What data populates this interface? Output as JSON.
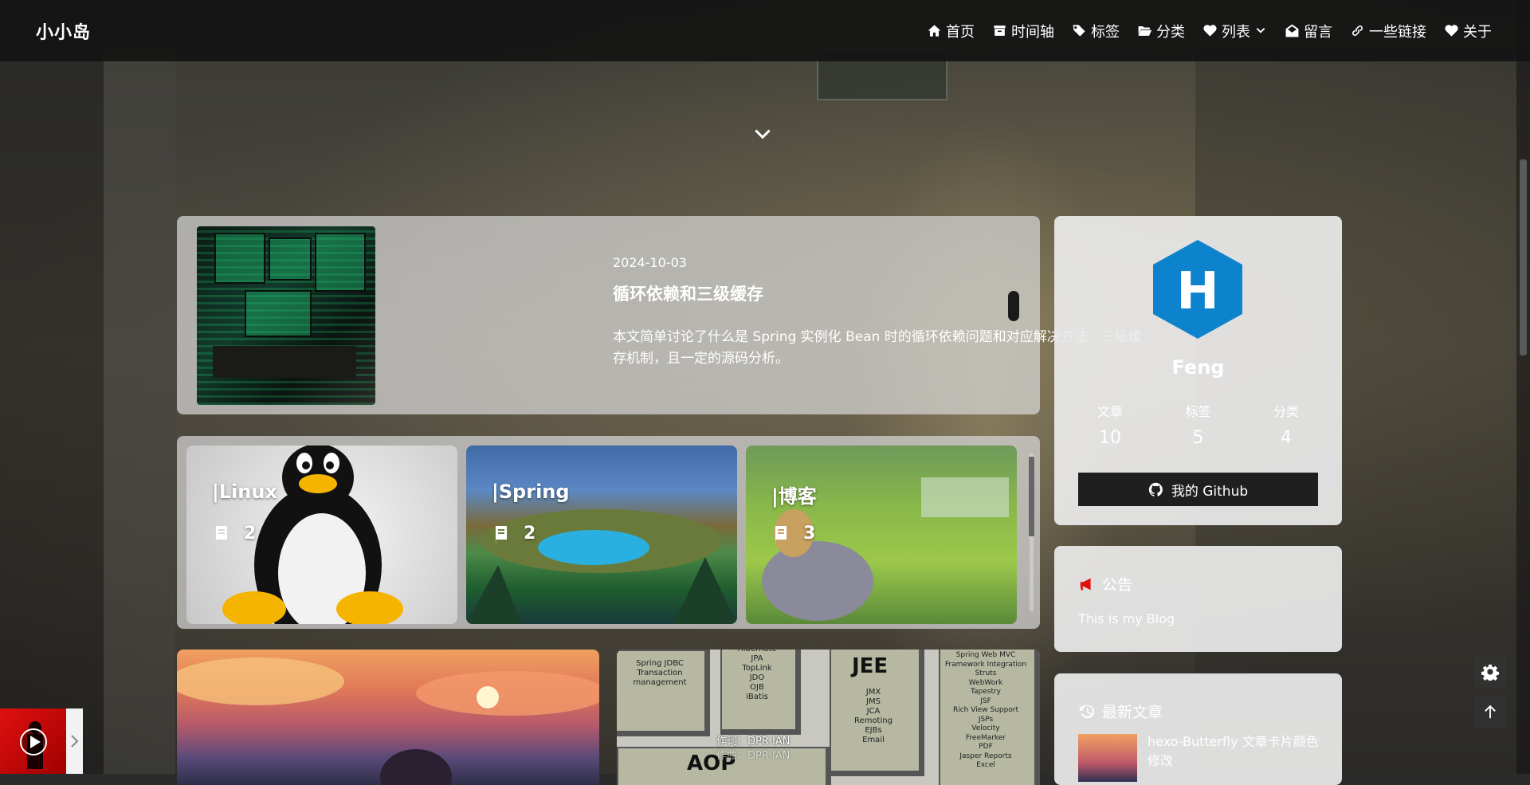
{
  "site": {
    "brand": "小小岛"
  },
  "nav": {
    "items": [
      {
        "label": "首页",
        "icon": "home-icon"
      },
      {
        "label": "时间轴",
        "icon": "archive-icon"
      },
      {
        "label": "标签",
        "icon": "tags-icon"
      },
      {
        "label": "分类",
        "icon": "folder-open-icon"
      },
      {
        "label": "列表",
        "icon": "heartbeat-icon"
      },
      {
        "label": "留言",
        "icon": "envelope-open-icon"
      },
      {
        "label": "一些链接",
        "icon": "link-icon"
      },
      {
        "label": "关于",
        "icon": "heart-icon"
      }
    ]
  },
  "featured_post": {
    "date": "2024-10-03",
    "title": "循环依赖和三级缓存",
    "excerpt": "本文简单讨论了什么是 Spring 实例化 Bean 时的循环依赖问题和对应解决方法：三级缓存机制，且一定的源码分析。"
  },
  "categories": [
    {
      "name": "|Linux",
      "count": "2"
    },
    {
      "name": "|Spring",
      "count": "2"
    },
    {
      "name": "|博客",
      "count": "3"
    }
  ],
  "bottom_cards": {
    "jee_title": "JEE",
    "aop_title": "AOP",
    "credit_lyric": "作词：DPR IAN",
    "credit_music": "作曲：DPR IAN",
    "jee_lists": {
      "col1": "Spring JDBC\nTransaction\nmanagement",
      "col2": "Hibernate\nJPA\nTopLink\nJDO\nOJB\niBatis",
      "col3": "JMX\nJMS\nJCA\nRemoting\nEJBs\nEmail",
      "col4": "Spring Web MVC\nFramework Integration\nStruts\nWebWork\nTapestry\nJSF\nRich View Support\nJSPs\nVelocity\nFreeMarker\nPDF\nJasper Reports\nExcel"
    }
  },
  "profile": {
    "avatar_letter": "H",
    "author": "Feng",
    "stats": [
      {
        "label": "文章",
        "value": "10"
      },
      {
        "label": "标签",
        "value": "5"
      },
      {
        "label": "分类",
        "value": "4"
      }
    ],
    "github_label": "我的 Github"
  },
  "notice": {
    "title": "公告",
    "text": "This is my Blog"
  },
  "recent": {
    "title": "最新文章",
    "first_title": "hexo-Butterfly 文章卡片颜色修改"
  },
  "colors": {
    "nav_bg": "#141414",
    "accent_red": "#e01010",
    "hexo_blue": "#0e83cd",
    "github_btn": "#1f1f1f"
  }
}
